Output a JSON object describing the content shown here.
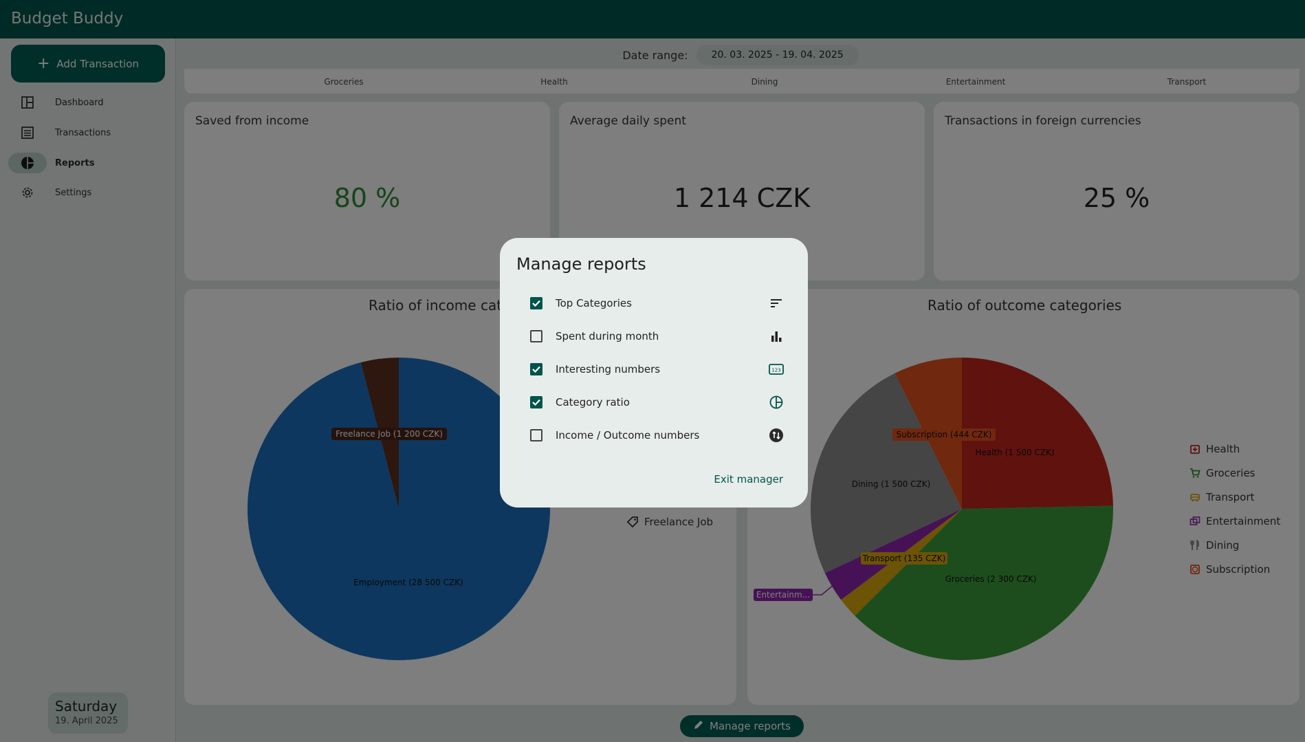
{
  "app": {
    "title": "Budget Buddy"
  },
  "sidebar": {
    "add_button": "Add Transaction",
    "items": [
      {
        "label": "Dashboard",
        "icon": "dashboard-icon",
        "active": false
      },
      {
        "label": "Transactions",
        "icon": "list-icon",
        "active": false
      },
      {
        "label": "Reports",
        "icon": "pie-chart-icon",
        "active": true
      },
      {
        "label": "Settings",
        "icon": "gear-icon",
        "active": false
      }
    ],
    "date_card": {
      "day": "Saturday",
      "date": "19. April 2025"
    }
  },
  "header": {
    "date_range_label": "Date range:",
    "date_range_value": "20. 03. 2025 - 19. 04. 2025"
  },
  "category_strip": [
    "Groceries",
    "Health",
    "Dining",
    "Entertainment",
    "Transport"
  ],
  "stats": [
    {
      "title": "Saved from income",
      "value": "80 %",
      "color": "#2c8a34"
    },
    {
      "title": "Average daily spent",
      "value": "1 214 CZK",
      "color": "#222222"
    },
    {
      "title": "Transactions in foreign currencies",
      "value": "25 %",
      "color": "#222222"
    }
  ],
  "income_chart": {
    "title": "Ratio of income categories",
    "legend": [
      {
        "label": "Freelance Job",
        "icon": "tag-icon"
      }
    ]
  },
  "outcome_chart": {
    "title": "Ratio of outcome categories",
    "legend": [
      {
        "label": "Health",
        "icon": "medical-icon",
        "color": "#c0241f"
      },
      {
        "label": "Groceries",
        "icon": "cart-icon",
        "color": "#2e8b2e"
      },
      {
        "label": "Transport",
        "icon": "car-icon",
        "color": "#d9a60a"
      },
      {
        "label": "Entertainment",
        "icon": "ticket-icon",
        "color": "#8e24aa"
      },
      {
        "label": "Dining",
        "icon": "cutlery-icon",
        "color": "#7a7a7a"
      },
      {
        "label": "Subscription",
        "icon": "subscription-icon",
        "color": "#e0501c"
      }
    ]
  },
  "chart_data": [
    {
      "type": "pie",
      "title": "Ratio of income categories",
      "labels": [
        "Employment",
        "Freelance Job"
      ],
      "values": [
        28500,
        1200
      ],
      "unit": "CZK",
      "slice_labels": [
        "Employment (28 500 CZK)",
        "Freelance Job (1 200 CZK)"
      ],
      "colors": [
        "#1a6fbf",
        "#5b2e1e"
      ]
    },
    {
      "type": "pie",
      "title": "Ratio of outcome categories",
      "labels": [
        "Health",
        "Groceries",
        "Transport",
        "Entertainment",
        "Dining",
        "Subscription"
      ],
      "values": [
        1500,
        2300,
        135,
        200,
        1500,
        444
      ],
      "unit": "CZK",
      "slice_labels": [
        "Health (1 500 CZK)",
        "Groceries (2 300 CZK)",
        "Transport (135 CZK)",
        "Entertainm...",
        "Dining (1 500 CZK)",
        "Subscription (444 CZK)"
      ],
      "colors": [
        "#c0241f",
        "#3d9a3a",
        "#d9a60a",
        "#8e24aa",
        "#8a8a8a",
        "#e0501c"
      ]
    }
  ],
  "manage_button": "Manage reports",
  "modal": {
    "title": "Manage reports",
    "items": [
      {
        "label": "Top Categories",
        "checked": true,
        "icon": "sort-icon"
      },
      {
        "label": "Spent during month",
        "checked": false,
        "icon": "bar-chart-icon"
      },
      {
        "label": "Interesting numbers",
        "checked": true,
        "icon": "numbers-icon"
      },
      {
        "label": "Category ratio",
        "checked": true,
        "icon": "pie-chart-icon"
      },
      {
        "label": "Income / Outcome numbers",
        "checked": false,
        "icon": "swap-icon"
      }
    ],
    "exit_label": "Exit manager"
  }
}
